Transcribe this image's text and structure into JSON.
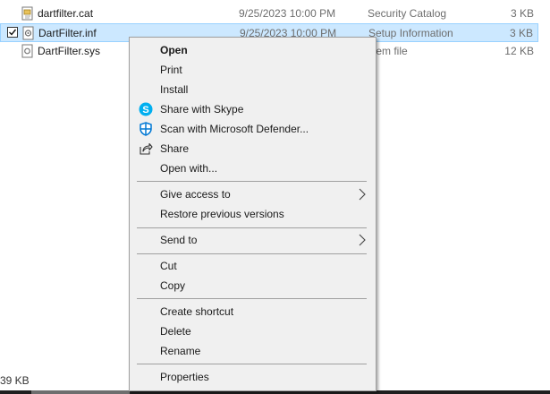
{
  "files": [
    {
      "name": "dartfilter.cat",
      "date": "9/25/2023 10:00 PM",
      "type": "Security Catalog",
      "size": "3 KB",
      "icon": "catalog-file-icon",
      "selected": false
    },
    {
      "name": "DartFilter.inf",
      "date": "9/25/2023 10:00 PM",
      "type": "Setup Information",
      "size": "3 KB",
      "icon": "setup-file-icon",
      "selected": true
    },
    {
      "name": "DartFilter.sys",
      "date": "",
      "type": "stem file",
      "size": "12 KB",
      "icon": "system-file-icon",
      "selected": false
    }
  ],
  "status": {
    "size_text": "39 KB"
  },
  "context_menu": {
    "items": [
      {
        "label": "Open",
        "bold": true
      },
      {
        "label": "Print"
      },
      {
        "label": "Install"
      },
      {
        "label": "Share with Skype",
        "icon": "skype-icon"
      },
      {
        "label": "Scan with Microsoft Defender...",
        "icon": "defender-icon"
      },
      {
        "label": "Share",
        "icon": "share-icon"
      },
      {
        "label": "Open with..."
      },
      {
        "label": "Give access to",
        "submenu": true
      },
      {
        "label": "Restore previous versions"
      },
      {
        "label": "Send to",
        "submenu": true
      },
      {
        "label": "Cut"
      },
      {
        "label": "Copy"
      },
      {
        "label": "Create shortcut"
      },
      {
        "label": "Delete"
      },
      {
        "label": "Rename"
      },
      {
        "label": "Properties"
      }
    ]
  },
  "colors": {
    "selection": "#cce8ff",
    "menu_bg": "#f0f0f0",
    "skype": "#00aff0",
    "defender": "#0078d4"
  }
}
